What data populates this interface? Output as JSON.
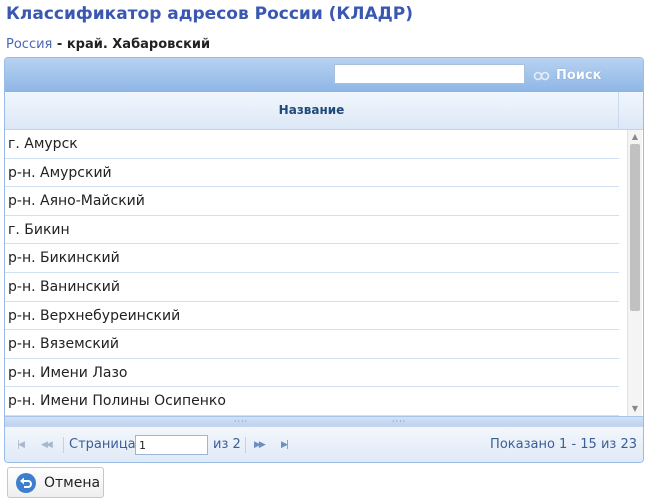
{
  "page": {
    "title": "Классификатор адресов России (КЛАДР)"
  },
  "breadcrumb": {
    "root": "Россия",
    "separator": " - ",
    "current": "край. Хабаровский"
  },
  "toolbar": {
    "search_value": "",
    "search_label": "Поиск"
  },
  "table": {
    "columns": [
      "Название"
    ],
    "rows": [
      "г. Амурск",
      "р-н. Амурский",
      "р-н. Аяно-Майский",
      "г. Бикин",
      "р-н. Бикинский",
      "р-н. Ванинский",
      "р-н. Верхнебуреинский",
      "р-н. Вяземский",
      "р-н. Имени Лазо",
      "р-н. Имени Полины Осипенко"
    ]
  },
  "pager": {
    "page_label": "Страница",
    "page_value": "1",
    "of_label": "из 2",
    "info": "Показано 1 - 15 из 23"
  },
  "actions": {
    "cancel_label": "Отмена"
  },
  "colors": {
    "title": "#3a58b2",
    "header_text": "#1f4a7a",
    "toolbar": "#9fc1ea",
    "accent": "#3e7fcd"
  }
}
